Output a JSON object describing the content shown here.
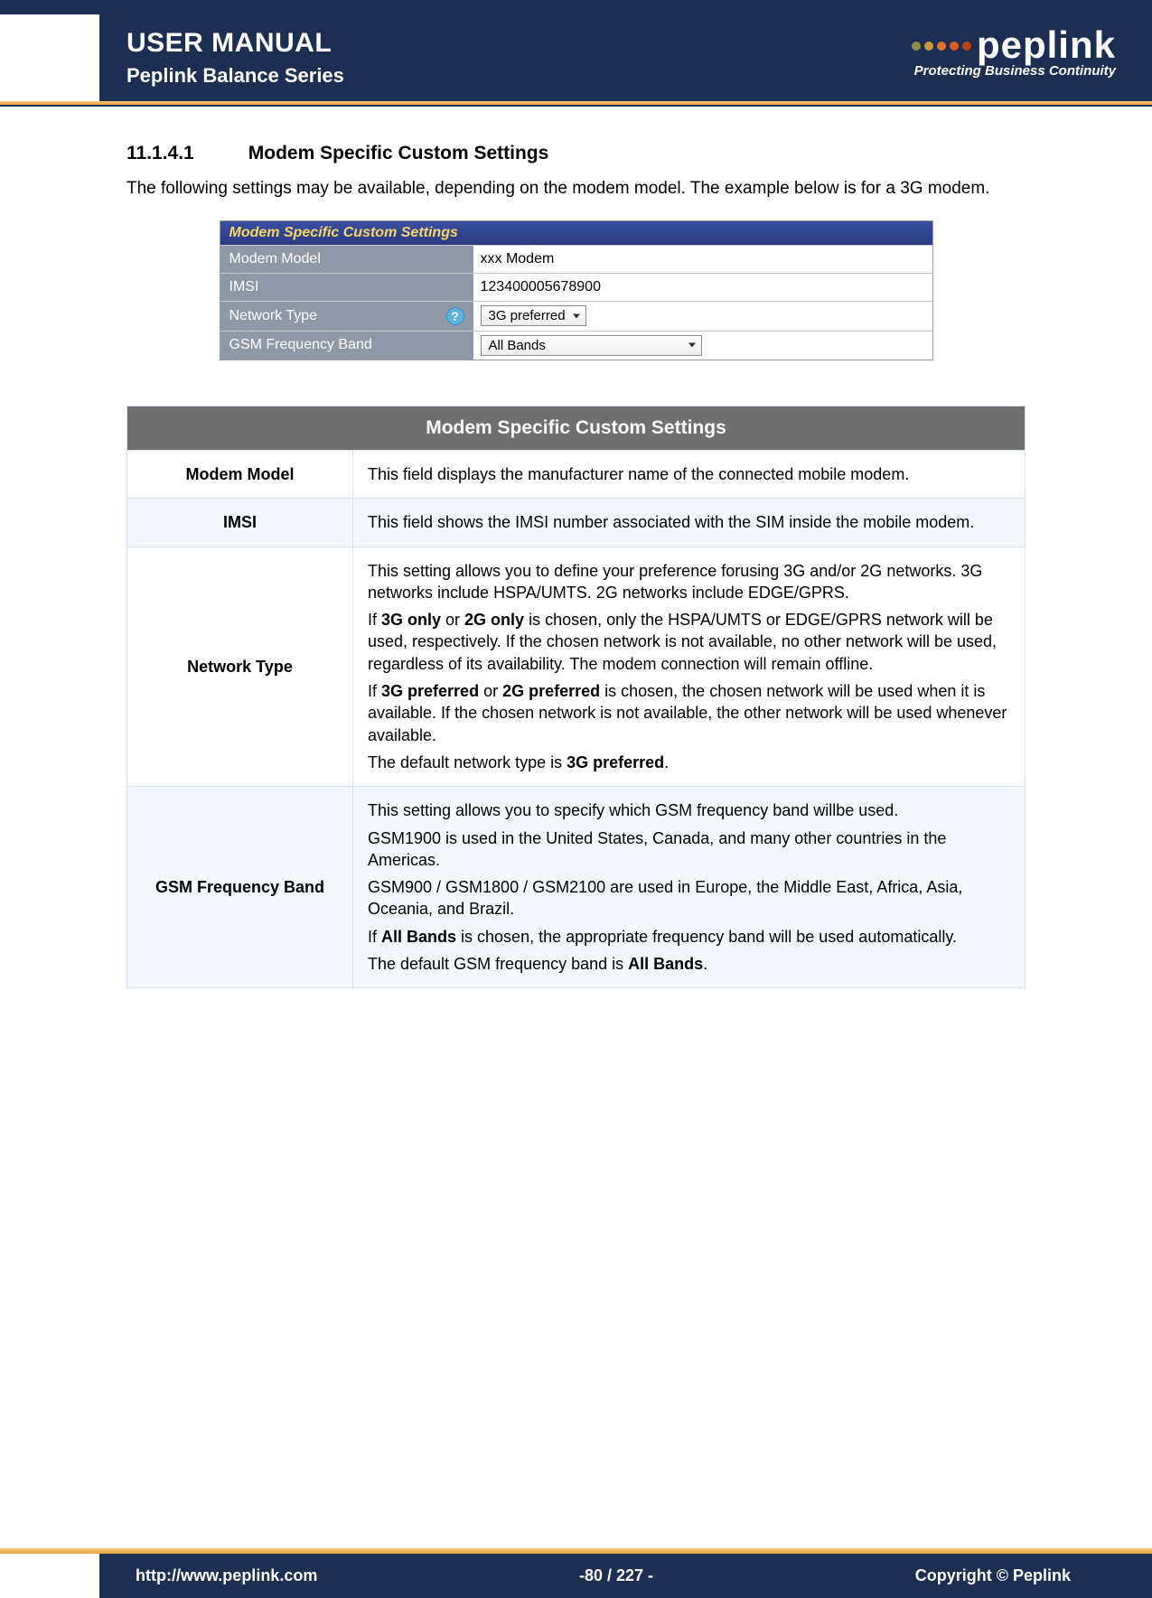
{
  "header": {
    "title": "USER MANUAL",
    "subtitle": "Peplink Balance Series",
    "logo_text": "peplink",
    "tagline": "Protecting Business Continuity",
    "dot_colors": [
      "#8a8f44",
      "#c79b3a",
      "#e0742c",
      "#d85a1f",
      "#c13f1a"
    ]
  },
  "section": {
    "number": "11.1.4.1",
    "title": "Modem Specific Custom Settings",
    "intro": "The following settings may be available, depending on the modem model. The example below is for a 3G modem."
  },
  "ui_shot": {
    "title": "Modem Specific Custom Settings",
    "rows": [
      {
        "label": "Modem Model",
        "value": "xxx Modem",
        "type": "text"
      },
      {
        "label": "IMSI",
        "value": "123400005678900",
        "type": "text"
      },
      {
        "label": "Network Type",
        "value": "3G preferred",
        "type": "select-small",
        "help": true
      },
      {
        "label": "GSM Frequency Band",
        "value": "All Bands",
        "type": "select-large"
      }
    ]
  },
  "explain": {
    "header": "Modem Specific Custom Settings",
    "rows": [
      {
        "name": "Modem Model",
        "paras": [
          "This field displays the manufacturer name of the connected mobile modem."
        ]
      },
      {
        "name": "IMSI",
        "paras": [
          "This field shows the IMSI number associated with the SIM inside the mobile modem."
        ]
      },
      {
        "name": "Network Type",
        "paras_html": "<p>This setting allows you to define your preference forusing 3G and/or 2G networks. 3G networks include HSPA/UMTS. 2G networks include EDGE/GPRS.</p><p>If <b>3G only</b> or <b>2G only</b> is chosen, only the HSPA/UMTS or EDGE/GPRS network will be used, respectively. If the chosen network is not available, no other network will be used, regardless of its availability. The modem connection will remain offline.</p><p>If <b>3G preferred</b> or <b>2G preferred</b> is chosen, the chosen network will be used when it is available. If the chosen network is not available, the other network will be used whenever available.</p><p>The default network type is <b>3G preferred</b>.</p>"
      },
      {
        "name": "GSM Frequency Band",
        "paras_html": "<p>This setting allows you to specify which GSM frequency band willbe used.</p><p>GSM1900 is used in the United States, Canada, and many other countries in the Americas.</p><p>GSM900 / GSM1800 / GSM2100 are used in Europe, the Middle East, Africa, Asia, Oceania, and Brazil.</p><p>If <b>All Bands</b> is chosen, the appropriate frequency band will be used automatically.</p><p>The default GSM frequency band is <b>All Bands</b>.</p>"
      }
    ]
  },
  "footer": {
    "url": "http://www.peplink.com",
    "page": "-80 / 227 -",
    "copyright": "Copyright ©  Peplink"
  }
}
